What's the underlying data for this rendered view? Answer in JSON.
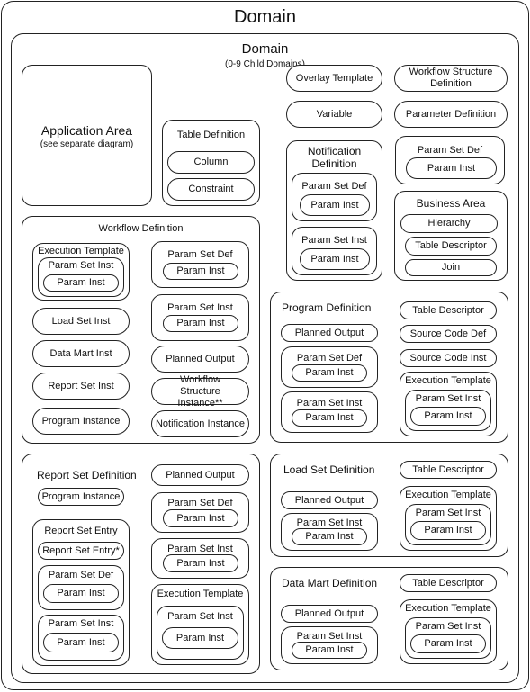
{
  "outer": {
    "title": "Domain"
  },
  "inner": {
    "title": "Domain",
    "subtitle": "(0-9 Child Domains)"
  },
  "app_area": {
    "title": "Application Area",
    "subtitle": "(see separate diagram)"
  },
  "table_def": {
    "title": "Table Definition",
    "items": [
      "Column",
      "Constraint"
    ]
  },
  "top_right": {
    "overlay": "Overlay Template",
    "wsd": "Workflow Structure Definition",
    "variable": "Variable",
    "param_def": "Parameter Definition"
  },
  "notif_def": {
    "title": "Notification Definition",
    "psd": "Param Set Def",
    "psi": "Param Set Inst",
    "pi": "Param Inst"
  },
  "psd_box": {
    "title": "Param Set Def",
    "pi": "Param Inst"
  },
  "business_area": {
    "title": "Business Area",
    "items": [
      "Hierarchy",
      "Table Descriptor",
      "Join"
    ]
  },
  "workflow_def": {
    "title": "Workflow Definition",
    "exec": "Execution Template",
    "psi": "Param Set Inst",
    "pi": "Param Inst",
    "left": [
      "Load Set Inst",
      "Data Mart Inst",
      "Report Set Inst",
      "Program Instance"
    ],
    "psd": "Param Set Def",
    "planned": "Planned Output",
    "wsi": "Workflow Structure Instance**",
    "notif": "Notification Instance"
  },
  "program_def": {
    "title": "Program Definition",
    "planned": "Planned Output",
    "psd": "Param Set  Def",
    "psi": "Param Set Inst",
    "pi": "Param Inst",
    "td": "Table Descriptor",
    "scd": "Source Code Def",
    "sci": "Source Code Inst",
    "exec": "Execution Template"
  },
  "report_set_def": {
    "title": "Report Set Definition",
    "prog_inst": "Program Instance",
    "entry": "Report Set Entry",
    "entry_star": "Report Set Entry*",
    "psd": "Param Set Def",
    "psi": "Param Set Inst",
    "pi": "Param Inst",
    "planned": "Planned Output",
    "exec": "Execution Template"
  },
  "load_set_def": {
    "title": "Load Set Definition",
    "td": "Table Descriptor",
    "planned": "Planned Output",
    "psi": "Param Set Inst",
    "pi": "Param Inst",
    "exec": "Execution Template"
  },
  "data_mart_def": {
    "title": "Data Mart Definition",
    "td": "Table Descriptor",
    "planned": "Planned Output",
    "psi": "Param Set Inst",
    "pi": "Param Inst",
    "exec": "Execution Template"
  }
}
